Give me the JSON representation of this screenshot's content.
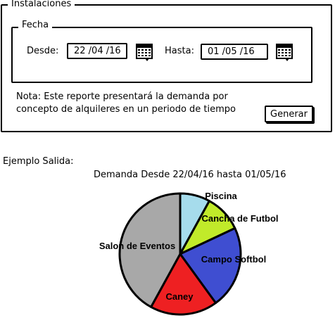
{
  "form": {
    "outer_legend": "Instalaciones",
    "inner_legend": "Fecha",
    "from_label": "Desde:",
    "from_value": "22 /04 /16",
    "to_label": "Hasta:",
    "to_value": "01 /05 /16",
    "note_line1": "Nota: Este reporte presentará la demanda por",
    "note_line2": "concepto de alquileres en un periodo de tiempo",
    "generate_label": "Generar",
    "calendar_icon": "calendar-icon"
  },
  "output": {
    "example_label": "Ejemplo Salida:"
  },
  "chart_data": {
    "type": "pie",
    "title": "Demanda Desde 22/04/16 hasta 01/05/16",
    "categories": [
      "Piscina",
      "Cancha de Futbol",
      "Campo Softbol",
      "Caney",
      "Salon de Eventos"
    ],
    "values": [
      8,
      10,
      22,
      18,
      42
    ],
    "colors": [
      "#a6dcec",
      "#c1ea2a",
      "#3f4ed1",
      "#ee2022",
      "#a8a8a8"
    ]
  }
}
